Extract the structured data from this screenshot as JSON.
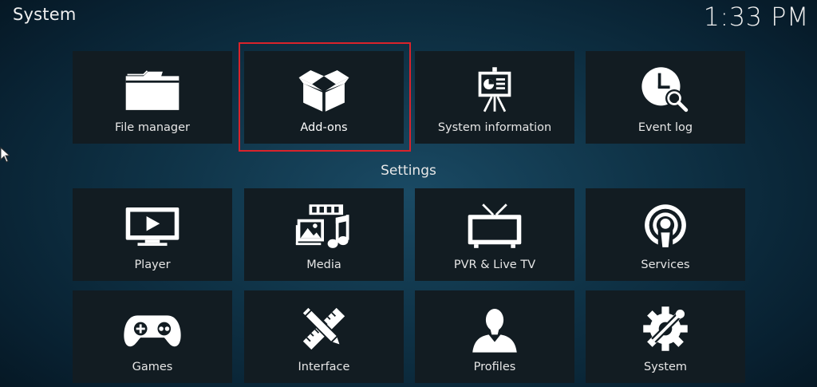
{
  "header": {
    "title": "System",
    "clock": "1:33 PM"
  },
  "top_row": [
    {
      "label": "File manager",
      "icon": "folder-icon"
    },
    {
      "label": "Add-ons",
      "icon": "open-box-icon"
    },
    {
      "label": "System information",
      "icon": "presentation-easel-icon"
    },
    {
      "label": "Event log",
      "icon": "clock-search-icon"
    }
  ],
  "settings": {
    "heading": "Settings",
    "items": [
      {
        "label": "Player",
        "icon": "play-monitor-icon"
      },
      {
        "label": "Media",
        "icon": "media-photo-music-icon"
      },
      {
        "label": "PVR & Live TV",
        "icon": "tv-antenna-icon"
      },
      {
        "label": "Services",
        "icon": "podcast-broadcast-icon"
      },
      {
        "label": "Games",
        "icon": "gamepad-icon"
      },
      {
        "label": "Interface",
        "icon": "pencil-ruler-icon"
      },
      {
        "label": "Profiles",
        "icon": "user-silhouette-icon"
      },
      {
        "label": "System",
        "icon": "gear-tools-icon"
      }
    ]
  },
  "focus": {
    "selected": "Add-ons",
    "highlight_color": "#d9232b"
  },
  "colors": {
    "tile_background": "#121c22",
    "background_center": "#1a4a64",
    "background_edge": "#04121c"
  }
}
